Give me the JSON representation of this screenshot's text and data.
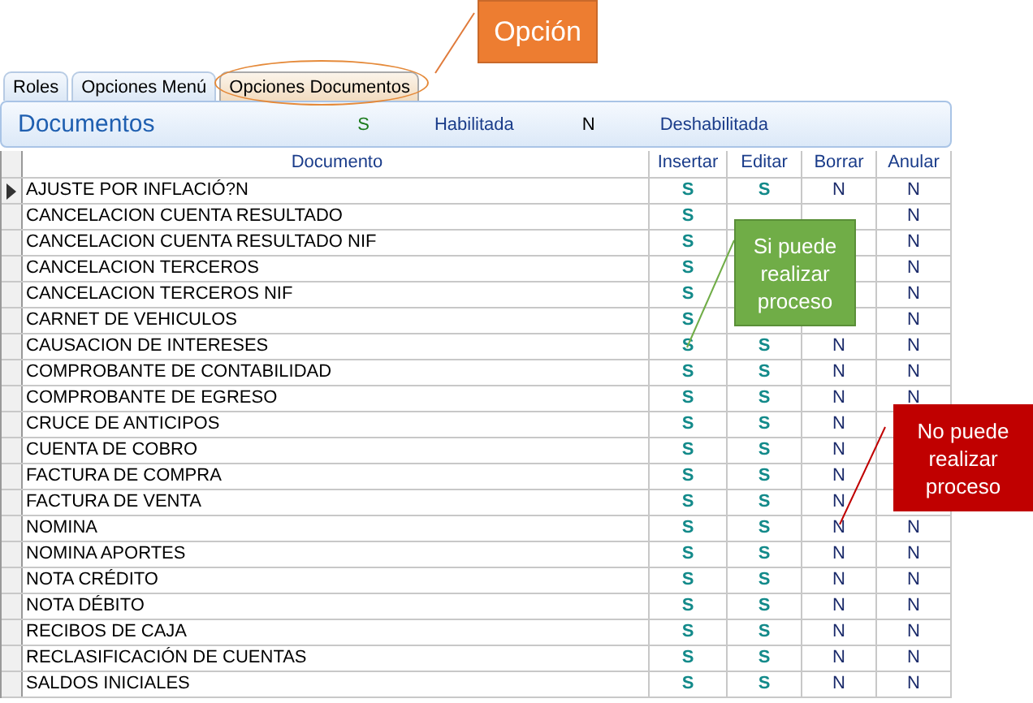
{
  "tabs": [
    {
      "label": "Roles",
      "selected": false
    },
    {
      "label": "Opciones Menú",
      "selected": false
    },
    {
      "label": "Opciones  Documentos",
      "selected": true
    }
  ],
  "header": {
    "title": "Documentos",
    "legend": [
      {
        "code": "S",
        "label": "Habilitada"
      },
      {
        "code": "N",
        "label": "Deshabilitada"
      }
    ]
  },
  "table": {
    "columns": [
      "Documento",
      "Insertar",
      "Editar",
      "Borrar",
      "Anular"
    ],
    "rows": [
      {
        "documento": "AJUSTE POR INFLACIÓ?N",
        "insertar": "S",
        "editar": "S",
        "borrar": "N",
        "anular": "N",
        "selected": true
      },
      {
        "documento": "CANCELACION CUENTA RESULTADO",
        "insertar": "S",
        "editar": null,
        "borrar": null,
        "anular": "N",
        "selected": false
      },
      {
        "documento": "CANCELACION CUENTA RESULTADO NIF",
        "insertar": "S",
        "editar": null,
        "borrar": null,
        "anular": "N",
        "selected": false
      },
      {
        "documento": "CANCELACION TERCEROS",
        "insertar": "S",
        "editar": null,
        "borrar": null,
        "anular": "N",
        "selected": false
      },
      {
        "documento": "CANCELACION TERCEROS NIF",
        "insertar": "S",
        "editar": null,
        "borrar": null,
        "anular": "N",
        "selected": false
      },
      {
        "documento": "CARNET DE VEHICULOS",
        "insertar": "S",
        "editar": null,
        "borrar": null,
        "anular": "N",
        "selected": false
      },
      {
        "documento": "CAUSACION DE INTERESES",
        "insertar": "S",
        "editar": "S",
        "borrar": "N",
        "anular": "N",
        "selected": false
      },
      {
        "documento": "COMPROBANTE DE CONTABILIDAD",
        "insertar": "S",
        "editar": "S",
        "borrar": "N",
        "anular": "N",
        "selected": false
      },
      {
        "documento": "COMPROBANTE DE EGRESO",
        "insertar": "S",
        "editar": "S",
        "borrar": "N",
        "anular": "N",
        "selected": false
      },
      {
        "documento": "CRUCE DE ANTICIPOS",
        "insertar": "S",
        "editar": "S",
        "borrar": "N",
        "anular": null,
        "selected": false
      },
      {
        "documento": "CUENTA DE COBRO",
        "insertar": "S",
        "editar": "S",
        "borrar": "N",
        "anular": null,
        "selected": false
      },
      {
        "documento": "FACTURA DE COMPRA",
        "insertar": "S",
        "editar": "S",
        "borrar": "N",
        "anular": null,
        "selected": false
      },
      {
        "documento": "FACTURA DE VENTA",
        "insertar": "S",
        "editar": "S",
        "borrar": "N",
        "anular": null,
        "selected": false
      },
      {
        "documento": "NOMINA",
        "insertar": "S",
        "editar": "S",
        "borrar": "N",
        "anular": "N",
        "selected": false
      },
      {
        "documento": "NOMINA APORTES",
        "insertar": "S",
        "editar": "S",
        "borrar": "N",
        "anular": "N",
        "selected": false
      },
      {
        "documento": "NOTA CRÉDITO",
        "insertar": "S",
        "editar": "S",
        "borrar": "N",
        "anular": "N",
        "selected": false
      },
      {
        "documento": "NOTA DÉBITO",
        "insertar": "S",
        "editar": "S",
        "borrar": "N",
        "anular": "N",
        "selected": false
      },
      {
        "documento": "RECIBOS DE CAJA",
        "insertar": "S",
        "editar": "S",
        "borrar": "N",
        "anular": "N",
        "selected": false
      },
      {
        "documento": "RECLASIFICACIÓN DE CUENTAS",
        "insertar": "S",
        "editar": "S",
        "borrar": "N",
        "anular": "N",
        "selected": false
      },
      {
        "documento": "SALDOS INICIALES",
        "insertar": "S",
        "editar": "S",
        "borrar": "N",
        "anular": "N",
        "selected": false
      }
    ]
  },
  "callouts": [
    {
      "kind": "option",
      "text": "Opción"
    },
    {
      "kind": "yes",
      "text": "Si puede realizar proceso"
    },
    {
      "kind": "no",
      "text": "No puede realizar proceso"
    }
  ]
}
